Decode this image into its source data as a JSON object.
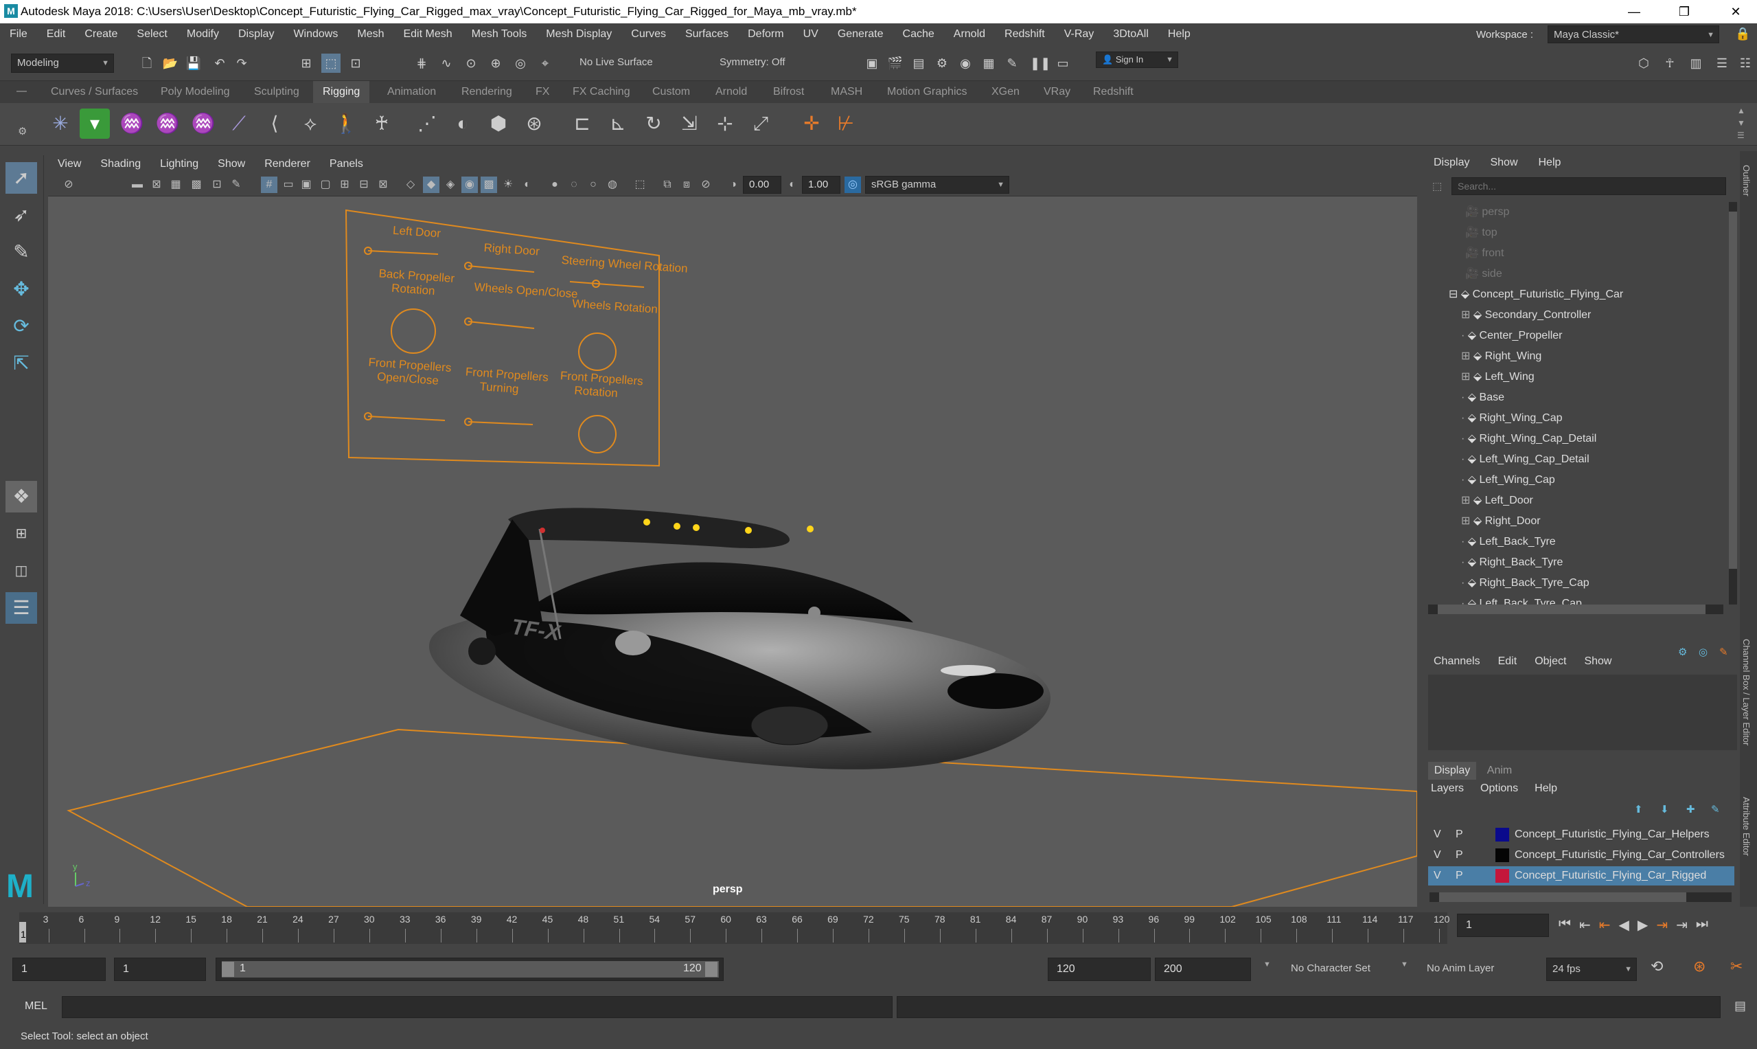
{
  "window": {
    "title": "Autodesk Maya 2018: C:\\Users\\User\\Desktop\\Concept_Futuristic_Flying_Car_Rigged_max_vray\\Concept_Futuristic_Flying_Car_Rigged_for_Maya_mb_vray.mb*",
    "minimize": "—",
    "maximize": "❐",
    "close": "✕"
  },
  "menubar": {
    "items": [
      "File",
      "Edit",
      "Create",
      "Select",
      "Modify",
      "Display",
      "Windows",
      "Mesh",
      "Edit Mesh",
      "Mesh Tools",
      "Mesh Display",
      "Curves",
      "Surfaces",
      "Deform",
      "UV",
      "Generate",
      "Cache",
      "Arnold",
      "Redshift",
      "V-Ray",
      "3DtoAll",
      "Help"
    ],
    "workspace_label": "Workspace :",
    "workspace_value": "Maya Classic*"
  },
  "statusline": {
    "mode": "Modeling",
    "live_surface": "No Live Surface",
    "symmetry": "Symmetry: Off",
    "sign_in": "Sign In"
  },
  "shelf": {
    "tabs": [
      "Curves / Surfaces",
      "Poly Modeling",
      "Sculpting",
      "Rigging",
      "Animation",
      "Rendering",
      "FX",
      "FX Caching",
      "Custom",
      "Arnold",
      "Bifrost",
      "MASH",
      "Motion Graphics",
      "XGen",
      "VRay",
      "Redshift"
    ],
    "active_tab": "Rigging"
  },
  "viewport": {
    "menu": [
      "View",
      "Shading",
      "Lighting",
      "Show",
      "Renderer",
      "Panels"
    ],
    "exposure": "0.00",
    "gamma": "1.00",
    "color_space": "sRGB gamma",
    "camera_label": "persp",
    "logo_text": "TF-X",
    "rig_panel_labels": {
      "left_door": "Left Door",
      "right_door": "Right Door",
      "steering": "Steering Wheel Rotation",
      "back_prop_1": "Back Propeller",
      "back_prop_2": "Rotation",
      "wheels_open": "Wheels Open/Close",
      "wheels_rot": "Wheels Rotation",
      "front_open_1": "Front Propellers",
      "front_open_2": "Open/Close",
      "front_turn_1": "Front Propellers",
      "front_turn_2": "Turning",
      "front_rot_1": "Front Propellers",
      "front_rot_2": "Rotation"
    }
  },
  "outliner": {
    "menu": [
      "Display",
      "Show",
      "Help"
    ],
    "search_placeholder": "Search...",
    "cameras": [
      "persp",
      "top",
      "front",
      "side"
    ],
    "root": "Concept_Futuristic_Flying_Car",
    "children": [
      {
        "name": "Secondary_Controller",
        "expand": "+"
      },
      {
        "name": "Center_Propeller",
        "expand": ""
      },
      {
        "name": "Right_Wing",
        "expand": "+"
      },
      {
        "name": "Left_Wing",
        "expand": "+"
      },
      {
        "name": "Base",
        "expand": ""
      },
      {
        "name": "Right_Wing_Cap",
        "expand": ""
      },
      {
        "name": "Right_Wing_Cap_Detail",
        "expand": ""
      },
      {
        "name": "Left_Wing_Cap_Detail",
        "expand": ""
      },
      {
        "name": "Left_Wing_Cap",
        "expand": ""
      },
      {
        "name": "Left_Door",
        "expand": "+"
      },
      {
        "name": "Right_Door",
        "expand": "+"
      },
      {
        "name": "Left_Back_Tyre",
        "expand": ""
      },
      {
        "name": "Right_Back_Tyre",
        "expand": ""
      },
      {
        "name": "Right_Back_Tyre_Cap",
        "expand": ""
      },
      {
        "name": "Left_Back_Tyre_Cap",
        "expand": ""
      }
    ]
  },
  "channelbox": {
    "menu": [
      "Channels",
      "Edit",
      "Object",
      "Show"
    ]
  },
  "layers": {
    "tabs": [
      "Display",
      "Anim"
    ],
    "menu": [
      "Layers",
      "Options",
      "Help"
    ],
    "items": [
      {
        "v": "V",
        "p": "P",
        "color": "#0a0a8c",
        "name": "Concept_Futuristic_Flying_Car_Helpers"
      },
      {
        "v": "V",
        "p": "P",
        "color": "#050505",
        "name": "Concept_Futuristic_Flying_Car_Controllers"
      },
      {
        "v": "V",
        "p": "P",
        "color": "#c4163b",
        "name": "Concept_Futuristic_Flying_Car_Rigged"
      }
    ]
  },
  "side_tabs": {
    "outliner": "Outliner",
    "channel_box": "Channel Box / Layer Editor",
    "attribute_editor": "Attribute Editor"
  },
  "timeline": {
    "ticks": [
      "3",
      "6",
      "9",
      "12",
      "15",
      "18",
      "21",
      "24",
      "27",
      "30",
      "33",
      "36",
      "39",
      "42",
      "45",
      "48",
      "51",
      "54",
      "57",
      "60",
      "63",
      "66",
      "69",
      "72",
      "75",
      "78",
      "81",
      "84",
      "87",
      "90",
      "93",
      "96",
      "99",
      "102",
      "105",
      "108",
      "111",
      "114",
      "117",
      "120"
    ],
    "first_tick": "1",
    "current_frame": "1"
  },
  "range": {
    "start": "1",
    "playback_start": "1",
    "slider_start": "1",
    "slider_end": "120",
    "playback_end": "120",
    "end": "200",
    "character_set": "No Character Set",
    "anim_layer": "No Anim Layer",
    "fps": "24 fps"
  },
  "command": {
    "label": "MEL"
  },
  "status": {
    "help": "Select Tool: select an object"
  },
  "colors": {
    "rig_orange": "#e08a1e",
    "layer_select": "#4a7ea6"
  }
}
